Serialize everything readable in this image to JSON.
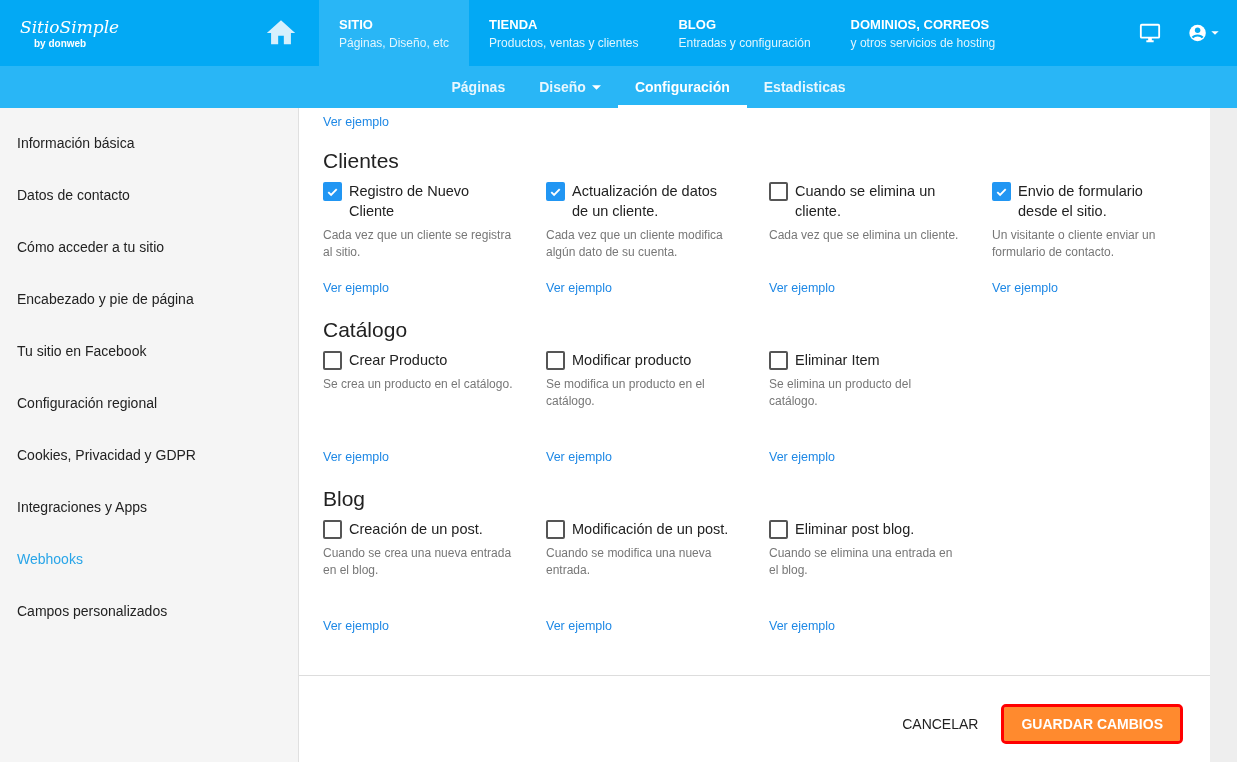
{
  "logo": {
    "name": "SitioSimple",
    "byline": "by donweb"
  },
  "main_nav": [
    {
      "title": "SITIO",
      "subtitle": "Páginas, Diseño, etc",
      "selected": true
    },
    {
      "title": "TIENDA",
      "subtitle": "Productos, ventas y clientes",
      "selected": false
    },
    {
      "title": "BLOG",
      "subtitle": "Entradas y configuración",
      "selected": false
    },
    {
      "title": "DOMINIOS, CORREOS",
      "subtitle": "y otros servicios de hosting",
      "selected": false
    }
  ],
  "sub_nav": [
    {
      "label": "Páginas",
      "selected": false,
      "dropdown": false
    },
    {
      "label": "Diseño",
      "selected": false,
      "dropdown": true
    },
    {
      "label": "Configuración",
      "selected": true,
      "dropdown": false
    },
    {
      "label": "Estadisticas",
      "selected": false,
      "dropdown": false
    }
  ],
  "sidebar": {
    "items": [
      {
        "label": "Información básica",
        "selected": false
      },
      {
        "label": "Datos de contacto",
        "selected": false
      },
      {
        "label": "Cómo acceder a tu sitio",
        "selected": false
      },
      {
        "label": "Encabezado y pie de página",
        "selected": false
      },
      {
        "label": "Tu sitio en Facebook",
        "selected": false
      },
      {
        "label": "Configuración regional",
        "selected": false
      },
      {
        "label": "Cookies, Privacidad y GDPR",
        "selected": false
      },
      {
        "label": "Integraciones y Apps",
        "selected": false
      },
      {
        "label": "Webhooks",
        "selected": true
      },
      {
        "label": "Campos personalizados",
        "selected": false
      }
    ]
  },
  "top_link": "Ver ejemplo",
  "sections": [
    {
      "title": "Clientes",
      "items": [
        {
          "label": "Registro de Nuevo Cliente",
          "checked": true,
          "description": "Cada vez que un cliente se registra al sitio.",
          "link": "Ver ejemplo"
        },
        {
          "label": "Actualización de datos de un cliente.",
          "checked": true,
          "description": "Cada vez que un cliente modifica algún dato de su cuenta.",
          "link": "Ver ejemplo"
        },
        {
          "label": "Cuando se elimina un cliente.",
          "checked": false,
          "description": "Cada vez que se elimina un cliente.",
          "link": "Ver ejemplo"
        },
        {
          "label": "Envio de formulario desde el sitio.",
          "checked": true,
          "description": "Un visitante o cliente enviar un formulario de contacto.",
          "link": "Ver ejemplo"
        }
      ]
    },
    {
      "title": "Catálogo",
      "items": [
        {
          "label": "Crear Producto",
          "checked": false,
          "description": "Se crea un producto en el catálogo.",
          "link": "Ver ejemplo"
        },
        {
          "label": "Modificar producto",
          "checked": false,
          "description": "Se modifica un producto en el catálogo.",
          "link": "Ver ejemplo"
        },
        {
          "label": "Eliminar Item",
          "checked": false,
          "description": "Se elimina un producto del catálogo.",
          "link": "Ver ejemplo"
        }
      ]
    },
    {
      "title": "Blog",
      "items": [
        {
          "label": "Creación de un post.",
          "checked": false,
          "description": "Cuando se crea una nueva entrada en el blog.",
          "link": "Ver ejemplo"
        },
        {
          "label": "Modificación de un post.",
          "checked": false,
          "description": "Cuando se modifica una nueva entrada.",
          "link": "Ver ejemplo"
        },
        {
          "label": "Eliminar post blog.",
          "checked": false,
          "description": "Cuando se elimina una entrada en el blog.",
          "link": "Ver ejemplo"
        }
      ]
    }
  ],
  "footer": {
    "cancel": "CANCELAR",
    "save": "GUARDAR CAMBIOS",
    "save_highlighted": true
  }
}
